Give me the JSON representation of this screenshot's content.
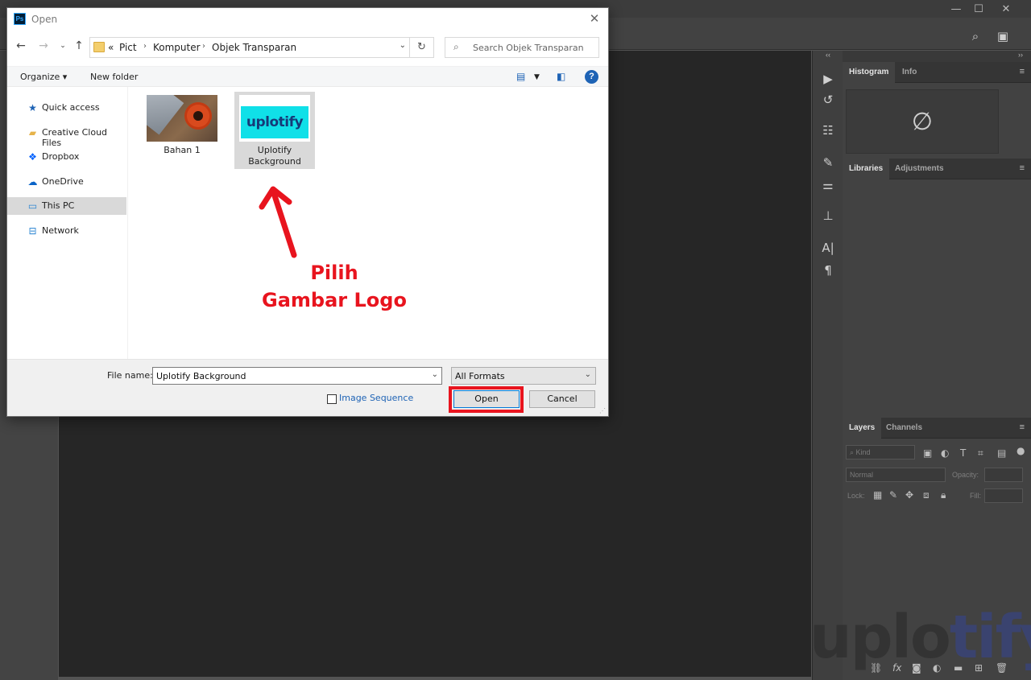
{
  "photoshop": {
    "window_controls": {
      "minimize": "—",
      "maximize": "☐",
      "close": "✕"
    },
    "options_icons": {
      "search": "⌕",
      "workspace": "▣"
    },
    "panels": {
      "group1_tabs": [
        "Histogram",
        "Info"
      ],
      "group2_tabs": [
        "Libraries",
        "Adjustments"
      ],
      "group3_tabs": [
        "Layers",
        "Channels"
      ],
      "histogram_empty_icon": "∅",
      "layers": {
        "kind_placeholder": "Kind",
        "blend_mode": "Normal",
        "opacity_label": "Opacity:",
        "lock_label": "Lock:",
        "fill_label": "Fill:"
      }
    },
    "watermark": {
      "part1": "uplo",
      "part2": "tify"
    }
  },
  "dialog": {
    "title": "Open",
    "app_badge": "Ps",
    "address": {
      "overflow": "«",
      "crumbs": [
        "Pict",
        "Komputer",
        "Objek Transparan"
      ]
    },
    "search": {
      "placeholder": "Search Objek Transparan"
    },
    "commands": {
      "organize": "Organize ▾",
      "new_folder": "New folder",
      "help": "?"
    },
    "nav_items": [
      {
        "label": "Quick access",
        "icon": "star-icon"
      },
      {
        "label": "Creative Cloud Files",
        "icon": "cc-folder-icon"
      },
      {
        "label": "Dropbox",
        "icon": "dropbox-icon"
      },
      {
        "label": "OneDrive",
        "icon": "cloud-icon"
      },
      {
        "label": "This PC",
        "icon": "computer-icon",
        "selected": true
      },
      {
        "label": "Network",
        "icon": "network-icon"
      }
    ],
    "files": [
      {
        "name": "Bahan 1"
      },
      {
        "name": "Uplotify Background",
        "thumb_text": "uplotify",
        "selected": true
      }
    ],
    "annotation": {
      "line1": "Pilih",
      "line2": "Gambar Logo",
      "color": "#e8141e"
    },
    "bottom": {
      "file_name_label": "File name:",
      "file_name_value": "Uplotify Background",
      "format_value": "All Formats",
      "image_sequence_label": "Image Sequence",
      "image_sequence_checked": false,
      "open_label": "Open",
      "cancel_label": "Cancel"
    }
  }
}
